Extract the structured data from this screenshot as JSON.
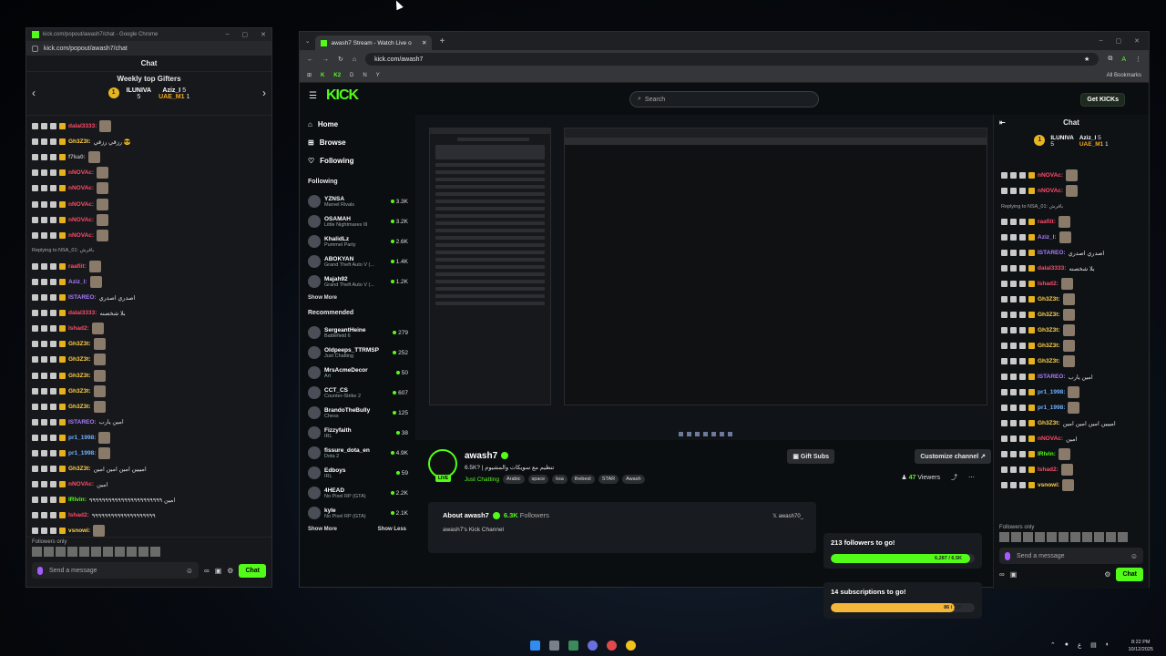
{
  "popout": {
    "window_title": "kick.com/popout/awash7/chat - Google Chrome",
    "url": "kick.com/popout/awash7/chat",
    "chat_header": "Chat",
    "gifters_title": "Weekly top Gifters",
    "gifter1": "ILUNIVA",
    "gifter1_count": "5",
    "gifter2": "Aziz_I",
    "gifter2_count": "5",
    "gifter3": "UAE_M1",
    "gifter3_count": "1",
    "messages": [
      {
        "user": "dalal3333:",
        "text": "",
        "color": "u-red"
      },
      {
        "user": "Gh3Z3t:",
        "text": "رزقي رزقي 😎",
        "color": "u-yel"
      },
      {
        "user": "f7ka0:",
        "text": "",
        "color": "u-gry"
      },
      {
        "user": "nNOVAc:",
        "text": "",
        "color": "u-red"
      },
      {
        "user": "nNOVAc:",
        "text": "",
        "color": "u-red"
      },
      {
        "user": "nNOVAc:",
        "text": "",
        "color": "u-red"
      },
      {
        "user": "nNOVAc:",
        "text": "",
        "color": "u-red"
      },
      {
        "user": "nNOVAc:",
        "text": "",
        "color": "u-red"
      },
      {
        "user": "Replying to NSA_01: باقرش",
        "text": "",
        "color": "u-gry"
      },
      {
        "user": "raafiit:",
        "text": "",
        "color": "u-red"
      },
      {
        "user": "Aziz_I:",
        "text": "",
        "color": "u-pur"
      },
      {
        "user": "ISTAREO:",
        "text": "اصدري اصدري",
        "color": "u-pur"
      },
      {
        "user": "dalal3333:",
        "text": "بلا شخصنه",
        "color": "u-red"
      },
      {
        "user": "Ishad2:",
        "text": "",
        "color": "u-red"
      },
      {
        "user": "Gh3Z3t:",
        "text": "",
        "color": "u-yel"
      },
      {
        "user": "Gh3Z3t:",
        "text": "",
        "color": "u-yel"
      },
      {
        "user": "Gh3Z3t:",
        "text": "",
        "color": "u-yel"
      },
      {
        "user": "Gh3Z3t:",
        "text": "",
        "color": "u-yel"
      },
      {
        "user": "Gh3Z3t:",
        "text": "",
        "color": "u-yel"
      },
      {
        "user": "ISTAREO:",
        "text": "امين يارب",
        "color": "u-pur"
      },
      {
        "user": "pr1_1998:",
        "text": "",
        "color": "u-blu"
      },
      {
        "user": "pr1_1998:",
        "text": "",
        "color": "u-blu"
      },
      {
        "user": "Gh3Z3t:",
        "text": "امييين امين امين امين",
        "color": "u-yel"
      },
      {
        "user": "nNOVAc:",
        "text": "امين",
        "color": "u-red"
      },
      {
        "user": "IRlvin:",
        "text": "امين ٩٩٩٩٩٩٩٩٩٩٩٩٩٩٩٩٩٩٩٩٩٩٩",
        "color": "u-grn"
      },
      {
        "user": "Ishad2:",
        "text": "٩٩٩٩٩٩٩٩٩٩٩٩٩٩٩٩٩٩٩٩",
        "color": "u-red"
      },
      {
        "user": "vsnowi:",
        "text": "",
        "color": "u-yel"
      }
    ],
    "followers_only": "Followers only",
    "send_placeholder": "Send a message",
    "chat_button": "Chat"
  },
  "main": {
    "tab_title": "awash7 Stream - Watch Live o",
    "url": "kick.com/awash7",
    "bookmarks": [
      "K",
      "K2",
      "D",
      "N",
      "Y"
    ],
    "all_bookmarks": "All Bookmarks",
    "logo": "KICK",
    "search_placeholder": "Search",
    "get_kicks": "Get KICKs",
    "nav": [
      {
        "label": "Home",
        "icon": "home-icon"
      },
      {
        "label": "Browse",
        "icon": "browse-icon"
      },
      {
        "label": "Following",
        "icon": "heart-icon"
      }
    ],
    "following_head": "Following",
    "following": [
      {
        "name": "YZNSA",
        "game": "Marvel Rivals",
        "viewers": "3.3K"
      },
      {
        "name": "OSAMAH",
        "game": "Little Nightmares III",
        "viewers": "3.2K"
      },
      {
        "name": "KhalidLz",
        "game": "Pummel Party",
        "viewers": "2.6K"
      },
      {
        "name": "ABOKYAN",
        "game": "Grand Theft Auto V (...",
        "viewers": "1.4K"
      },
      {
        "name": "Majah92",
        "game": "Grand Theft Auto V (...",
        "viewers": "1.2K"
      }
    ],
    "show_more": "Show More",
    "recommended_head": "Recommended",
    "recommended": [
      {
        "name": "SergeantHeine",
        "game": "Battlefield 6",
        "viewers": "279"
      },
      {
        "name": "Oldpeeps_TTRMSP",
        "game": "Just Chatting",
        "viewers": "252"
      },
      {
        "name": "MrsAcmeDecor",
        "game": "Art",
        "viewers": "50"
      },
      {
        "name": "CCT_CS",
        "game": "Counter-Strike 2",
        "viewers": "607"
      },
      {
        "name": "BrandoTheBully",
        "game": "Chess",
        "viewers": "125"
      },
      {
        "name": "Fizzyfaith",
        "game": "IRL",
        "viewers": "38"
      },
      {
        "name": "fissure_dota_en",
        "game": "Dota 2",
        "viewers": "4.9K"
      },
      {
        "name": "Edboys",
        "game": "IRL",
        "viewers": "59"
      },
      {
        "name": "4HEAD",
        "game": "No Pixel RP (GTA)",
        "viewers": "2.2K"
      },
      {
        "name": "kyle",
        "game": "No Pixel RP (GTA)",
        "viewers": "2.1K"
      }
    ],
    "show_more2": "Show More",
    "show_less": "Show Less",
    "streamer": "awash7",
    "stream_title": "6.5K? | تنظيم مع سويكات والمشيوم",
    "category": "Just Chatting",
    "tags": [
      "Arabic",
      "space",
      "ksa",
      "thebest",
      "STAR",
      "Awash"
    ],
    "live": "LIVE",
    "gift_subs": "Gift Subs",
    "customize": "Customize channel",
    "viewers_count": "47",
    "viewers_label": "Viewers",
    "about_title": "About awash7",
    "about_followers": "6.3K",
    "about_followers_label": "Followers",
    "about_desc": "awash7's Kick Channel",
    "x_handle": "awash70_",
    "goal1_title": "213 followers to go!",
    "goal1_value": "6,287 / 6.5K",
    "goal1_progress": 0.967,
    "goal2_title": "14 subscriptions to go!",
    "goal2_value": "86 / 100",
    "goal2_progress": 0.86
  },
  "right_chat": {
    "header": "Chat",
    "gifter1": "ILUNIVA",
    "gifter1_count": "5",
    "gifter2": "Aziz_I",
    "gifter2_count": "5",
    "gifter3": "UAE_M1",
    "gifter3_count": "1",
    "messages": [
      {
        "user": "nNOVAc:",
        "text": "",
        "color": "u-red"
      },
      {
        "user": "nNOVAc:",
        "text": "",
        "color": "u-red"
      },
      {
        "user": "Replying to NSA_01: باقرش",
        "text": "",
        "color": "u-gry"
      },
      {
        "user": "raafiit:",
        "text": "",
        "color": "u-red"
      },
      {
        "user": "Aziz_I:",
        "text": "",
        "color": "u-pur"
      },
      {
        "user": "ISTAREO:",
        "text": "اصدري اصدري",
        "color": "u-pur"
      },
      {
        "user": "dalal3333:",
        "text": "بلا شخصنه",
        "color": "u-red"
      },
      {
        "user": "Ishad2:",
        "text": "",
        "color": "u-red"
      },
      {
        "user": "Gh3Z3t:",
        "text": "",
        "color": "u-yel"
      },
      {
        "user": "Gh3Z3t:",
        "text": "",
        "color": "u-yel"
      },
      {
        "user": "Gh3Z3t:",
        "text": "",
        "color": "u-yel"
      },
      {
        "user": "Gh3Z3t:",
        "text": "",
        "color": "u-yel"
      },
      {
        "user": "Gh3Z3t:",
        "text": "",
        "color": "u-yel"
      },
      {
        "user": "ISTAREO:",
        "text": "امين يارب",
        "color": "u-pur"
      },
      {
        "user": "pr1_1998:",
        "text": "",
        "color": "u-blu"
      },
      {
        "user": "pr1_1998:",
        "text": "",
        "color": "u-blu"
      },
      {
        "user": "Gh3Z3t:",
        "text": "امييين امين امين امين",
        "color": "u-yel"
      },
      {
        "user": "nNOVAc:",
        "text": "امين",
        "color": "u-red"
      },
      {
        "user": "IRlvin:",
        "text": "",
        "color": "u-grn"
      },
      {
        "user": "Ishad2:",
        "text": "",
        "color": "u-red"
      },
      {
        "user": "vsnowi:",
        "text": "",
        "color": "u-yel"
      }
    ],
    "followers_only": "Followers only",
    "send_placeholder": "Send a message",
    "chat_button": "Chat"
  },
  "tray": {
    "time": "8:22 PM",
    "date": "10/12/2025",
    "lang": "ع"
  }
}
